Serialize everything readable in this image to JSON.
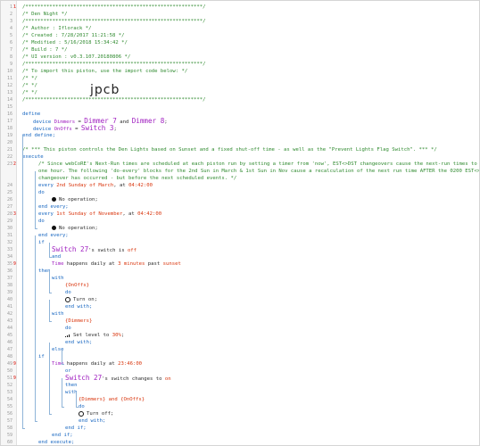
{
  "watermark": "jpcb",
  "lines": [
    {
      "n": "1",
      "t": "/***********************************************************/",
      "c": "cm"
    },
    {
      "n": "2",
      "t": "/* Den Night                                               */",
      "c": "cm"
    },
    {
      "n": "3",
      "t": "/***********************************************************/",
      "c": "cm"
    },
    {
      "n": "4",
      "t": "/* Author     : Iflorack                                   */",
      "c": "cm"
    },
    {
      "n": "5",
      "t": "/* Created    : 7/28/2017 11:21:58                         */",
      "c": "cm"
    },
    {
      "n": "6",
      "t": "/* Modified   : 5/16/2018 15:34:42                         */",
      "c": "cm"
    },
    {
      "n": "7",
      "t": "/* Build      : 7                                          */",
      "c": "cm"
    },
    {
      "n": "8",
      "t": "/* UI version : v0.3.107.20180806                          */",
      "c": "cm"
    },
    {
      "n": "9",
      "t": "/***********************************************************/",
      "c": "cm"
    },
    {
      "n": "10",
      "t": "/* To import this piston, use the import code below:      */",
      "c": "cm"
    },
    {
      "n": "11",
      "t": "/*                                                        */",
      "c": "cm"
    },
    {
      "n": "12",
      "t": "/*                                                        */",
      "c": "cm"
    },
    {
      "n": "13",
      "t": "/*                                                        */",
      "c": "cm"
    },
    {
      "n": "14",
      "t": "/***********************************************************/",
      "c": "cm"
    },
    {
      "n": "15",
      "t": ""
    },
    {
      "n": "16",
      "t": "define",
      "c": "kw"
    },
    {
      "n": "17",
      "t": "device Dimmers = Dimmer 7 and Dimmer 8;",
      "c": "dev1"
    },
    {
      "n": "18",
      "t": "device OnOffs = Switch 3;",
      "c": "dev2"
    },
    {
      "n": "19",
      "t": "end define;",
      "c": "kw"
    },
    {
      "n": "20",
      "t": ""
    },
    {
      "n": "21",
      "t": "/* *** This piston controls the Den Lights based on Sunset and a fixed shut-off time - as well as the \"Prevent Lights Flag Switch\". *** */",
      "c": "cm"
    },
    {
      "n": "22",
      "t": "execute",
      "c": "kw"
    },
    {
      "n": "23",
      "t": "/* Since webCoRE's Next-Run times are scheduled at each piston run by setting a timer from 'now', EST<>DST changeovers cause the next-run times to be off by",
      "c": "cm"
    },
    {
      "n": "",
      "t": "one hour. The following 'do-every' blocks for the 2nd Sun in March & 1st Sun in Nov cause a recalculation of the next run time AFTER the 0200 EST<>DST",
      "c": "cm"
    },
    {
      "n": "",
      "t": "changeover has occurred - but before the next scheduled events. */",
      "c": "cm"
    },
    {
      "n": "24",
      "t": "every 2nd Sunday of March, at 04:42:00"
    },
    {
      "n": "25",
      "t": "do"
    },
    {
      "n": "26",
      "t": "No operation;"
    },
    {
      "n": "27",
      "t": "end every;"
    },
    {
      "n": "28",
      "t": "every 1st Sunday of November, at 04:42:00"
    },
    {
      "n": "29",
      "t": "do"
    },
    {
      "n": "30",
      "t": "No operation;"
    },
    {
      "n": "31",
      "t": "end every;"
    },
    {
      "n": "32",
      "t": "if"
    },
    {
      "n": "33",
      "t": "Switch 27's switch is off"
    },
    {
      "n": "34",
      "t": "and"
    },
    {
      "n": "35",
      "t": "Time happens daily at 3 minutes past sunset"
    },
    {
      "n": "36",
      "t": "then"
    },
    {
      "n": "37",
      "t": "with"
    },
    {
      "n": "38",
      "t": "{OnOffs}"
    },
    {
      "n": "39",
      "t": "do"
    },
    {
      "n": "40",
      "t": "Turn on;"
    },
    {
      "n": "41",
      "t": "end with;"
    },
    {
      "n": "42",
      "t": "with"
    },
    {
      "n": "43",
      "t": "{Dimmers}"
    },
    {
      "n": "44",
      "t": "do"
    },
    {
      "n": "45",
      "t": "Set level to 30%;"
    },
    {
      "n": "46",
      "t": "end with;"
    },
    {
      "n": "47",
      "t": "else"
    },
    {
      "n": "48",
      "t": "if"
    },
    {
      "n": "49",
      "t": "Time happens daily at 23:46:00"
    },
    {
      "n": "50",
      "t": "or"
    },
    {
      "n": "51",
      "t": "Switch 27's switch changes to on"
    },
    {
      "n": "52",
      "t": "then"
    },
    {
      "n": "53",
      "t": "with"
    },
    {
      "n": "54",
      "t": "{Dimmers} and {OnOffs}"
    },
    {
      "n": "55",
      "t": "do"
    },
    {
      "n": "56",
      "t": "Turn off;"
    },
    {
      "n": "57",
      "t": "end with;"
    },
    {
      "n": "58",
      "t": "end if;"
    },
    {
      "n": "59",
      "t": "end if;"
    },
    {
      "n": "60",
      "t": "end execute;"
    }
  ],
  "markers": {
    "1": "1",
    "23": "2",
    "28": "3",
    "35": "9",
    "49": "9",
    "51": "9"
  },
  "colors": {
    "comment": "#2f8a2f",
    "keyword": "#1565c0",
    "device": "#a020c0",
    "value": "#d9350d",
    "guide": "#8fb4d8"
  },
  "icons": {
    "noop": "circle-dot-icon",
    "turn_on": "power-icon",
    "set_level": "level-bars-icon",
    "turn_off": "power-off-icon"
  }
}
